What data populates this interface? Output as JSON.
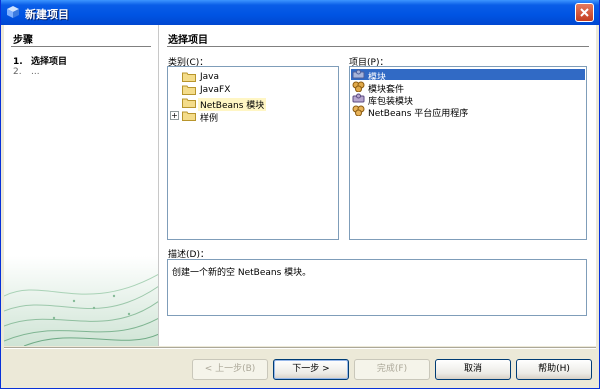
{
  "window": {
    "title": "新建项目"
  },
  "steps": {
    "title": "步骤",
    "items": [
      {
        "num": "1.",
        "label": "选择项目"
      },
      {
        "num": "2.",
        "label": "..."
      }
    ]
  },
  "main": {
    "title": "选择项目",
    "categories": {
      "label": "类别(C)：",
      "items": [
        "Java",
        "JavaFX",
        "NetBeans 模块",
        "样例"
      ],
      "selected": "NetBeans 模块"
    },
    "projects": {
      "label": "项目(P)：",
      "items": [
        "模块",
        "模块套件",
        "库包装模块",
        "NetBeans 平台应用程序"
      ],
      "selected": "模块"
    },
    "description": {
      "label": "描述(D)：",
      "text": "创建一个新的空 NetBeans 模块。"
    }
  },
  "buttons": {
    "back": "< 上一步(B)",
    "next": "下一步 >",
    "finish": "完成(F)",
    "cancel": "取消",
    "help": "帮助(H)"
  },
  "colors": {
    "accent": "#316ac5",
    "titlebar": "#0054e3",
    "panel": "#ece9d8"
  }
}
